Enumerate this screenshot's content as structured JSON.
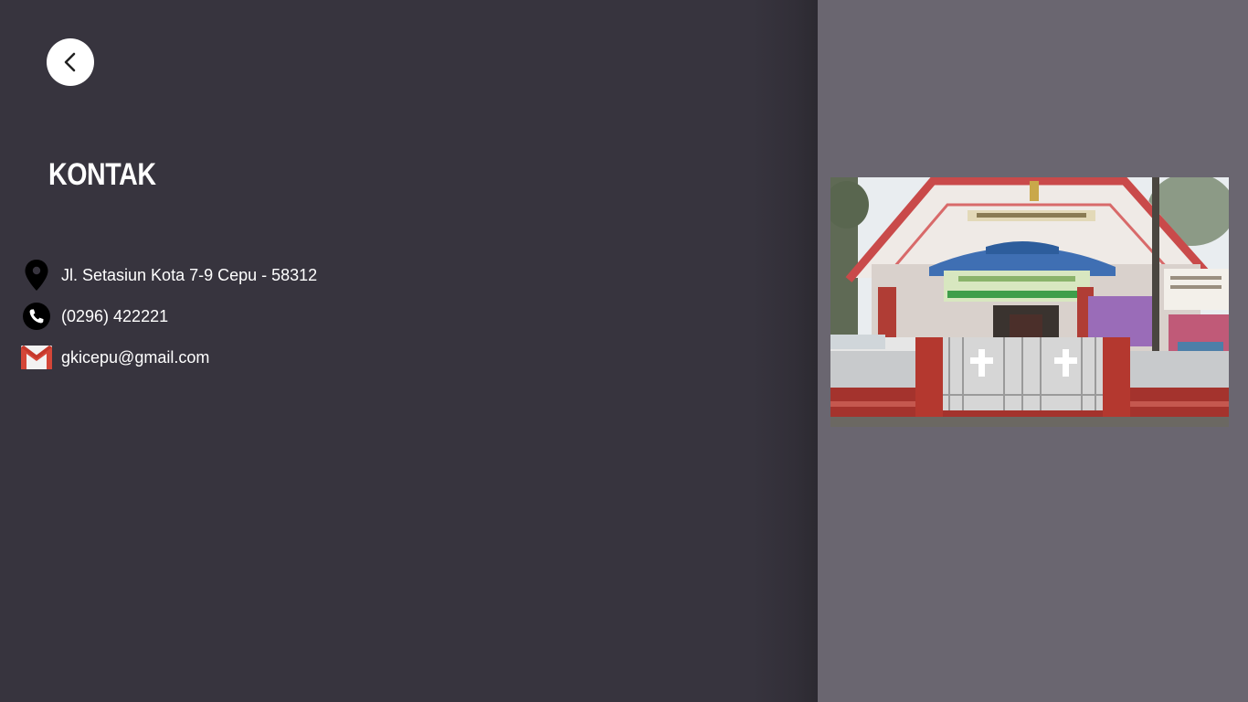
{
  "header": {
    "back_icon": "chevron-left-icon",
    "title": "KONTAK"
  },
  "contact": {
    "address": {
      "icon": "location-pin-icon",
      "text": "Jl. Setasiun Kota 7-9 Cepu - 58312"
    },
    "phone": {
      "icon": "phone-icon",
      "text": "(0296) 422221"
    },
    "email": {
      "icon": "gmail-icon",
      "text": "gkicepu@gmail.com"
    }
  },
  "colors": {
    "left_panel": "#37343e",
    "right_panel": "#6a6670",
    "text": "#ffffff"
  }
}
